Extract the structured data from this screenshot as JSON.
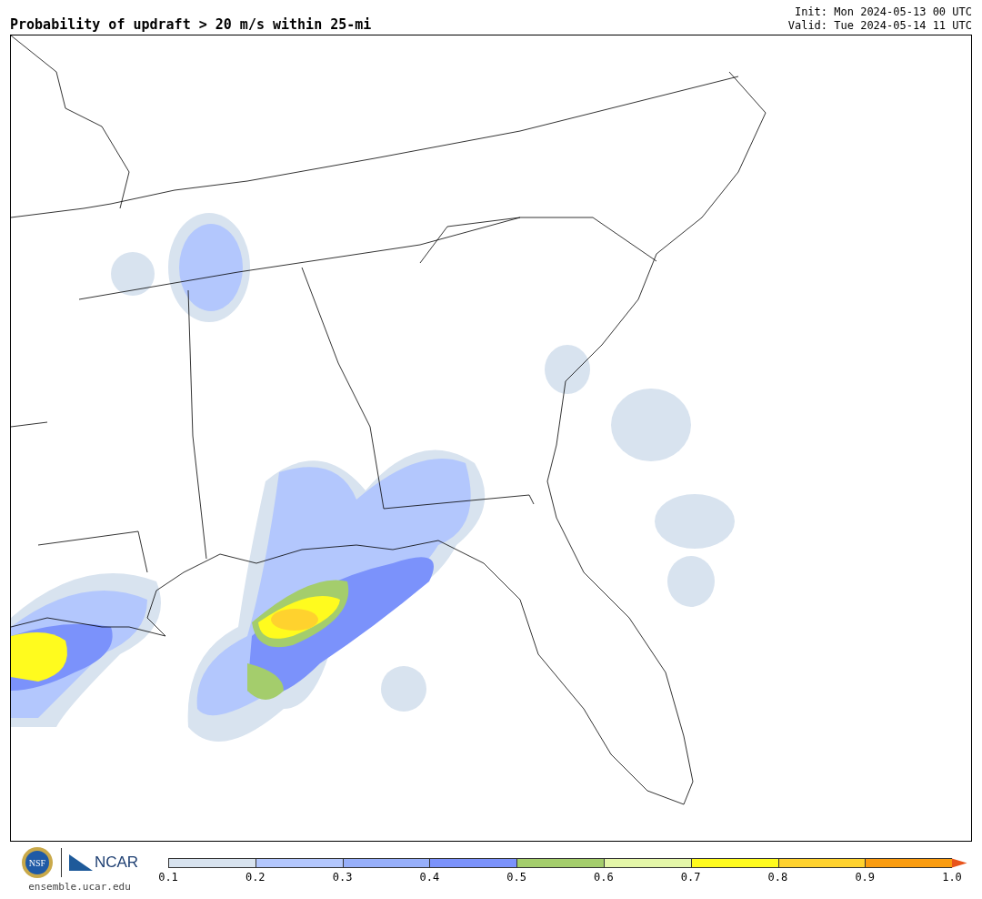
{
  "title": "Probability of updraft > 20 m/s within 25-mi",
  "init": "Init: Mon 2024-05-13 00 UTC",
  "valid": "Valid: Tue 2024-05-14 11 UTC",
  "logo": {
    "nsf": "NSF",
    "ncar": "NCAR",
    "url": "ensemble.ucar.edu"
  },
  "colorbar": {
    "segments": [
      {
        "color": "#d8e3ef"
      },
      {
        "color": "#b3c7fd"
      },
      {
        "color": "#97affa"
      },
      {
        "color": "#7b92fb"
      },
      {
        "color": "#a4cd6c"
      },
      {
        "color": "#e4f6a8"
      },
      {
        "color": "#fffb1e"
      },
      {
        "color": "#ffd22e"
      },
      {
        "color": "#fa9c10"
      },
      {
        "kind": "arrow",
        "color": "#e8541b"
      }
    ],
    "ticks": [
      "0.1",
      "0.2",
      "0.3",
      "0.4",
      "0.5",
      "0.6",
      "0.7",
      "0.8",
      "0.9",
      "1.0"
    ]
  }
}
